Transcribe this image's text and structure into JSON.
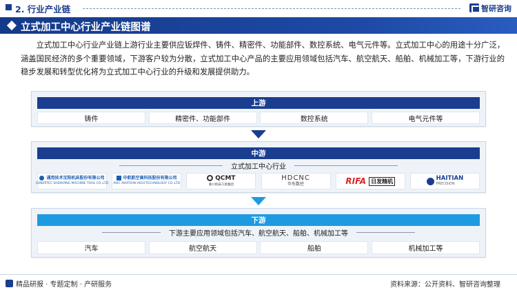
{
  "header": {
    "section_title": "2. 行业产业链",
    "logo_text": "智研咨询"
  },
  "banner": {
    "title": "立式加工中心行业产业链图谱"
  },
  "intro": "立式加工中心行业产业链上游行业主要供应钣焊件、铸件、精密件、功能部件、数控系统、电气元件等。立式加工中心的用途十分广泛，涵盖国民经济的多个重要领域，下游客户较为分散，立式加工中心产品的主要应用领域包括汽车、航空航天、船舶、机械加工等，下游行业的稳步发展和转型优化将为立式加工中心行业的升级和发展提供助力。",
  "upstream": {
    "title": "上游",
    "items": [
      "铸件",
      "精密件、功能部件",
      "数控系统",
      "电气元件等"
    ]
  },
  "midstream": {
    "title": "中游",
    "subtitle": "立式加工中心行业",
    "companies": [
      {
        "name": "通用技术沈阳机床股份有限公司",
        "sub": "GENERTEC SHENYANG MACHINE TOOL CO.,LTD",
        "icon": "sym-logo-icon",
        "color": "#1a5fb4"
      },
      {
        "name": "中航航空高科技股份有限公司",
        "sub": "AVIC AVIATION HIGH-TECHNOLOGY CO.,LTD",
        "icon": "avic-logo-icon",
        "color": "#1a5fb4"
      },
      {
        "name": "QCMT",
        "sub": "秦川机床工具集团",
        "icon": "qcmt-logo-icon",
        "color": "#222222"
      },
      {
        "name": "HDCNC",
        "sub": "华东数控",
        "icon": "hdcnc-logo-icon",
        "color": "#333333"
      },
      {
        "name": "RIFA",
        "sub": "日发精机",
        "icon": "rifa-logo-icon",
        "color": "#d62828"
      },
      {
        "name": "HAITIAN",
        "sub": "PRECISION",
        "icon": "haitian-logo-icon",
        "color": "#1a3d8f"
      }
    ]
  },
  "downstream": {
    "title": "下游",
    "subtitle": "下游主要应用领域包括汽车、航空航天、船舶、机械加工等",
    "items": [
      "汽车",
      "航空航天",
      "船舶",
      "机械加工等"
    ]
  },
  "footer": {
    "left": "精品研报 · 专题定制 · 产研服务",
    "right": "资料来源：公开资料、智研咨询整理"
  },
  "colors": {
    "primary": "#1a3d8f",
    "downstream": "#1e9be0",
    "panel_bg": "#eef3f9"
  }
}
